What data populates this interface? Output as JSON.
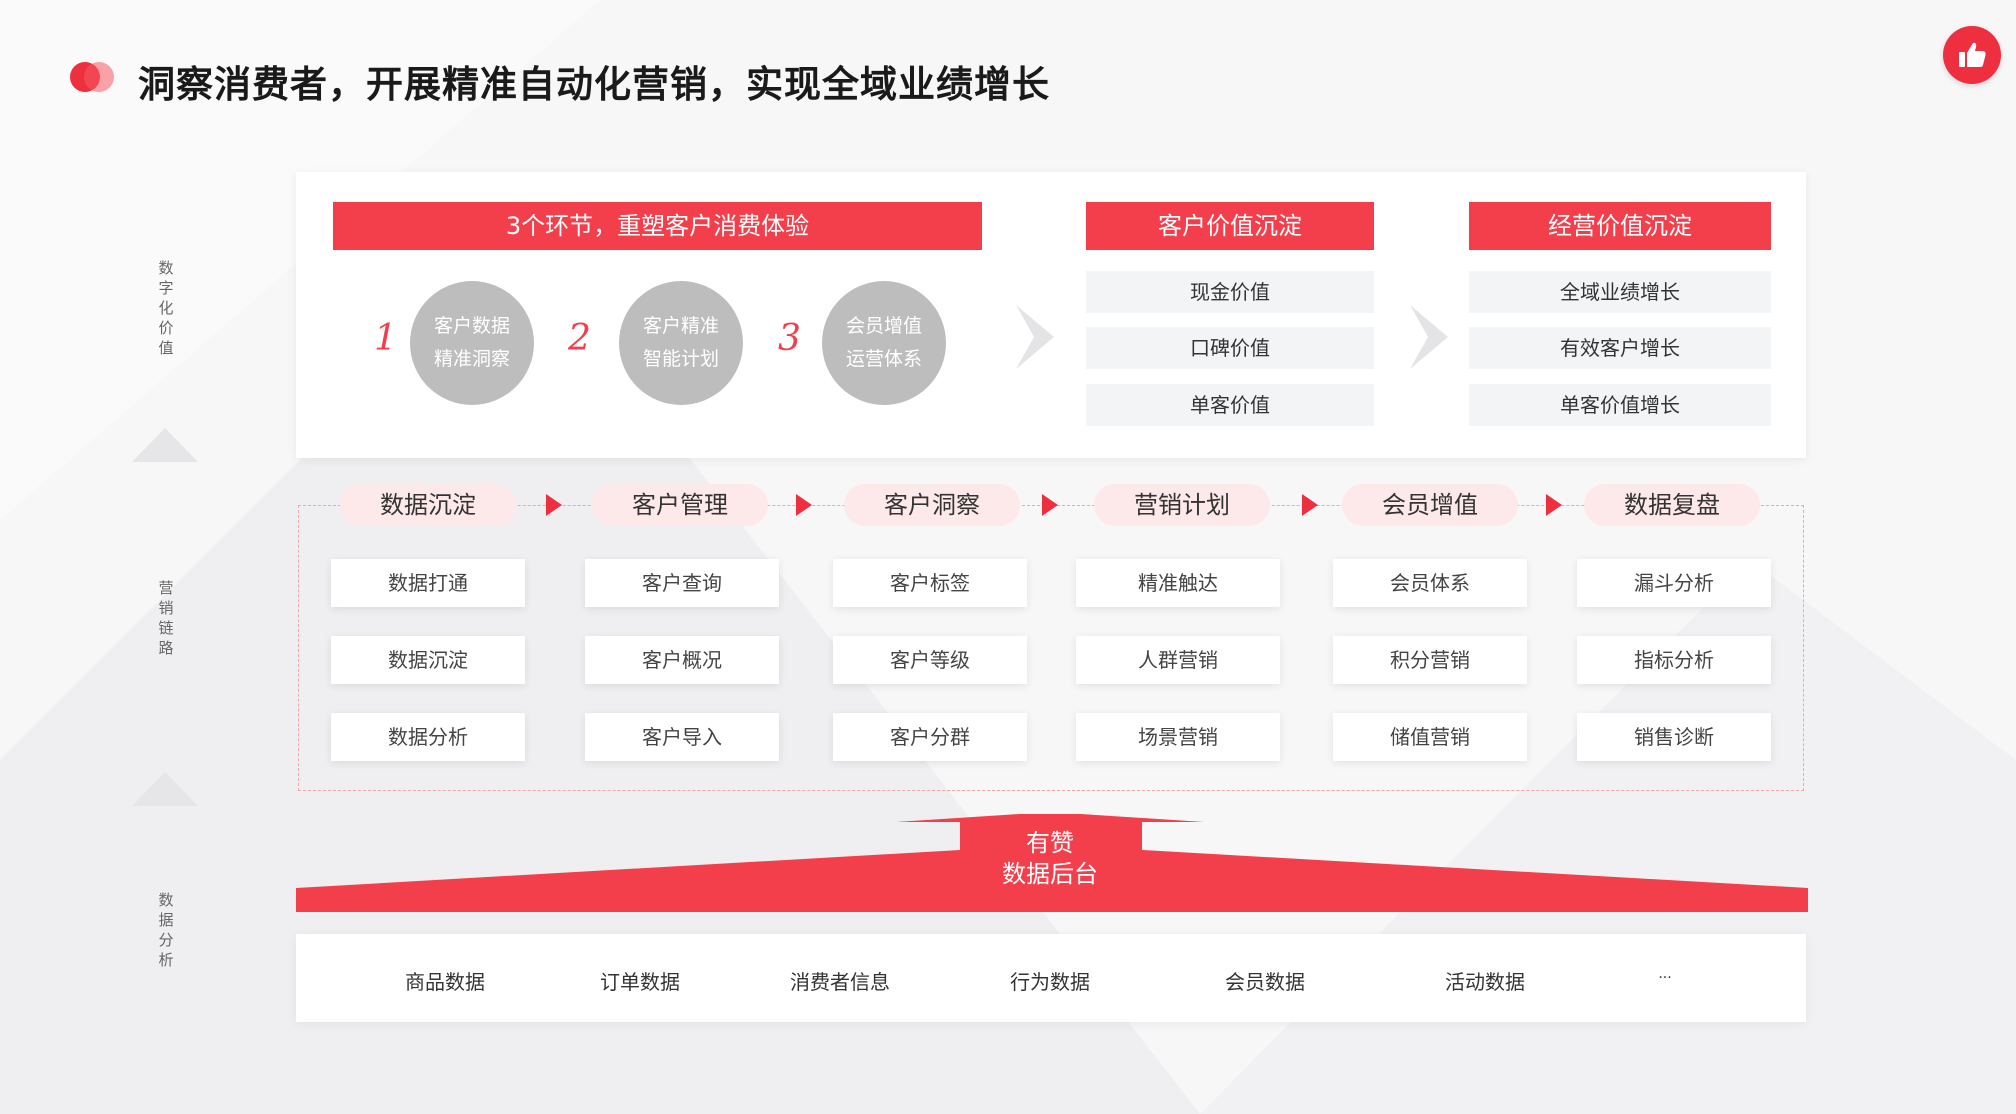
{
  "header": {
    "title": "洞察消费者，开展精准自动化营销，实现全域业绩增长"
  },
  "side_labels": {
    "value": [
      "数",
      "字",
      "化",
      "价",
      "值"
    ],
    "chain": [
      "营",
      "销",
      "链",
      "路"
    ],
    "analysis": [
      "数",
      "据",
      "分",
      "析"
    ]
  },
  "top": {
    "steps_header": "3个环节，重塑客户消费体验",
    "steps": [
      {
        "num": "1",
        "line1": "客户数据",
        "line2": "精准洞察"
      },
      {
        "num": "2",
        "line1": "客户精准",
        "line2": "智能计划"
      },
      {
        "num": "3",
        "line1": "会员增值",
        "line2": "运营体系"
      }
    ],
    "customer_value": {
      "header": "客户价值沉淀",
      "items": [
        "现金价值",
        "口碑价值",
        "单客价值"
      ]
    },
    "business_value": {
      "header": "经营价值沉淀",
      "items": [
        "全域业绩增长",
        "有效客户增长",
        "单客价值增长"
      ]
    }
  },
  "chain": {
    "stages": [
      "数据沉淀",
      "客户管理",
      "客户洞察",
      "营销计划",
      "会员增值",
      "数据复盘"
    ],
    "columns": [
      [
        "数据打通",
        "数据沉淀",
        "数据分析"
      ],
      [
        "客户查询",
        "客户概况",
        "客户导入"
      ],
      [
        "客户标签",
        "客户等级",
        "客户分群"
      ],
      [
        "精准触达",
        "人群营销",
        "场景营销"
      ],
      [
        "会员体系",
        "积分营销",
        "储值营销"
      ],
      [
        "漏斗分析",
        "指标分析",
        "销售诊断"
      ]
    ]
  },
  "platform": {
    "line1": "有赞",
    "line2": "数据后台"
  },
  "data_sources": [
    "商品数据",
    "订单数据",
    "消费者信息",
    "行为数据",
    "会员数据",
    "活动数据",
    "..."
  ],
  "colors": {
    "accent": "#f23f4b",
    "pill_bg": "#fde8ea",
    "circle": "#bdbdbd",
    "grey_cell": "#f3f4f6"
  },
  "icons": {
    "header_dots": "red-dot-pair",
    "top_right": "thumbs-up-icon",
    "separators": "chevron-right-icon",
    "side_separators": "triangle-up-icon"
  }
}
